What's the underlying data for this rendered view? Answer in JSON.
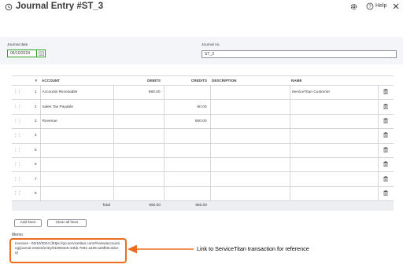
{
  "header": {
    "title": "Journal Entry #ST_3",
    "help_label": "Help"
  },
  "form": {
    "journal_date_label": "Journal date",
    "journal_date_value": "06/10/2024",
    "journal_no_label": "Journal no.",
    "journal_no_value": "ST_3"
  },
  "table": {
    "headers": {
      "num": "#",
      "account": "ACCOUNT",
      "debits": "DEBITS",
      "credits": "CREDITS",
      "description": "DESCRIPTION",
      "name": "NAME"
    },
    "rows": [
      {
        "num": "1",
        "account": "Accounts Receivable",
        "debits": "660.00",
        "credits": "",
        "description": "",
        "name": "ServiceTitan Customer"
      },
      {
        "num": "2",
        "account": "Sales Tax Payable",
        "debits": "",
        "credits": "60.00",
        "description": "",
        "name": ""
      },
      {
        "num": "3",
        "account": "Revenue",
        "debits": "",
        "credits": "600.00",
        "description": "",
        "name": ""
      },
      {
        "num": "4",
        "account": "",
        "debits": "",
        "credits": "",
        "description": "",
        "name": ""
      },
      {
        "num": "5",
        "account": "",
        "debits": "",
        "credits": "",
        "description": "",
        "name": ""
      },
      {
        "num": "6",
        "account": "",
        "debits": "",
        "credits": "",
        "description": "",
        "name": ""
      },
      {
        "num": "7",
        "account": "",
        "debits": "",
        "credits": "",
        "description": "",
        "name": ""
      },
      {
        "num": "8",
        "account": "",
        "debits": "",
        "credits": "",
        "description": "",
        "name": ""
      }
    ],
    "total_label": "Total",
    "total_debits": "660.00",
    "total_credits": "660.00"
  },
  "buttons": {
    "add_lines": "Add lines",
    "clear_all_lines": "Clear all lines"
  },
  "memo": {
    "label": "Memo",
    "text": "Invoices - 06/10/2024 (https://go.servicetitan.com/#/view/accounting/journal entries/entry/019004e5-34bb-7691-a408-ae5fb0c3dce0)"
  },
  "annotation": {
    "callout": "Link to ServiceTitan transaction for reference",
    "color": "#ee6c1f"
  },
  "icons": [
    "history-icon",
    "gear-icon",
    "help-icon",
    "close-icon",
    "calendar-icon",
    "drag-handle-icon",
    "trash-icon"
  ]
}
